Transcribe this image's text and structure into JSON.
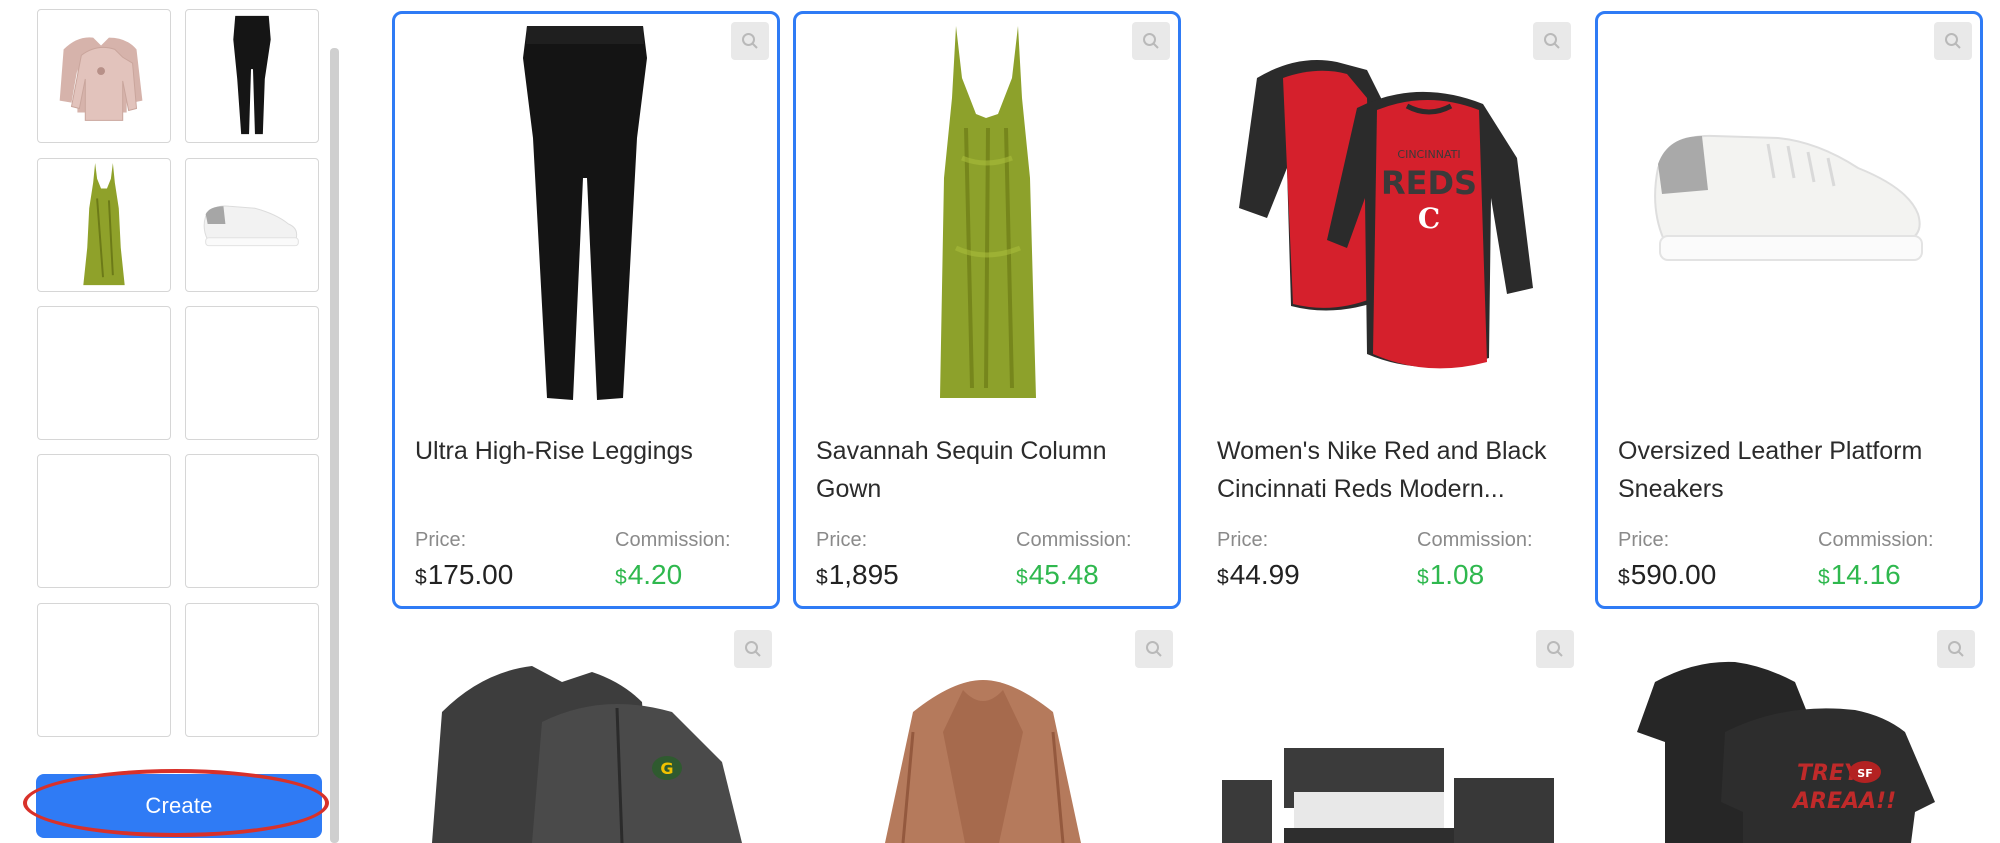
{
  "sidebar": {
    "create_label": "Create",
    "slots": [
      {
        "item": "pink-long-sleeve-shirt"
      },
      {
        "item": "black-leggings"
      },
      {
        "item": "green-sequin-gown"
      },
      {
        "item": "white-sneaker"
      },
      {
        "item": ""
      },
      {
        "item": ""
      },
      {
        "item": ""
      },
      {
        "item": ""
      },
      {
        "item": ""
      },
      {
        "item": ""
      }
    ]
  },
  "products": [
    {
      "name": "Ultra High-Rise Leggings",
      "price_label": "Price:",
      "currency": "$",
      "price": "175.00",
      "commission_label": "Commission:",
      "commission": "4.20",
      "selected": true
    },
    {
      "name": "Savannah Sequin Column Gown",
      "price_label": "Price:",
      "currency": "$",
      "price": "1,895",
      "commission_label": "Commission:",
      "commission": "45.48",
      "selected": true
    },
    {
      "name": "Women's Nike Red and Black Cincinnati Reds Modern...",
      "price_label": "Price:",
      "currency": "$",
      "price": "44.99",
      "commission_label": "Commission:",
      "commission": "1.08",
      "selected": false,
      "image_text": {
        "line1": "CINCINNATI",
        "line2": "REDS",
        "line3": "C"
      }
    },
    {
      "name": "Oversized Leather Platform Sneakers",
      "price_label": "Price:",
      "currency": "$",
      "price": "590.00",
      "commission_label": "Commission:",
      "commission": "14.16",
      "selected": true
    }
  ],
  "products_row2": [
    {
      "item": "green-bay-packers-quarter-zip-jackets",
      "image_text": "G"
    },
    {
      "item": "tan-leather-moto-jacket"
    },
    {
      "item": "dark-bedroom-set"
    },
    {
      "item": "san-francisco-49ers-black-tees",
      "image_text": {
        "line1": "TREY",
        "line2": "AREAA!!",
        "badge": "SF"
      }
    }
  ],
  "icons": {
    "zoom": "zoom-icon"
  },
  "colors": {
    "accent": "#2f7bf5",
    "commission": "#2fb84e",
    "highlight": "#d8312a"
  }
}
